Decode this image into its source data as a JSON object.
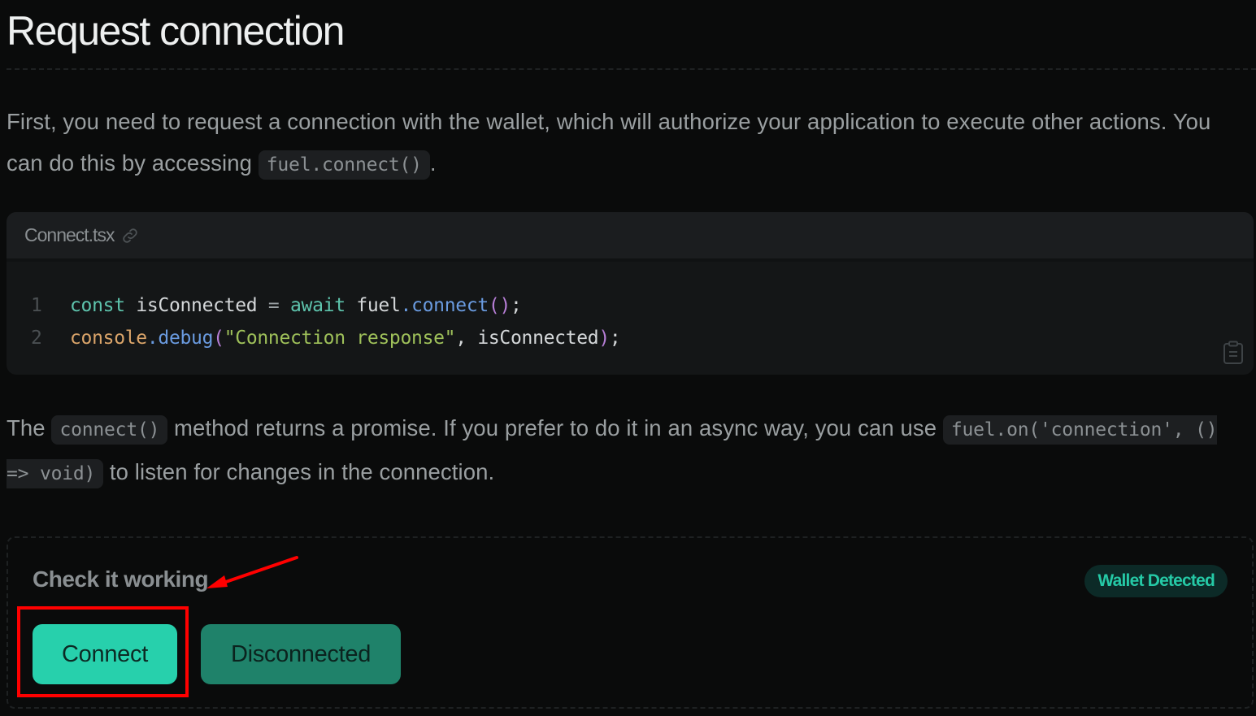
{
  "page": {
    "title": "Request connection"
  },
  "intro": {
    "text_before": "First, you need to request a connection with the wallet, which will authorize your application to execute other actions. You can do this by accessing ",
    "code": "fuel.connect()",
    "text_after": "."
  },
  "code_block": {
    "filename": "Connect.tsx",
    "link_icon": "link-icon",
    "copy_icon": "clipboard-icon",
    "lines": [
      {
        "number": "1",
        "tokens": [
          {
            "t": "const",
            "c": "kw"
          },
          {
            "t": " ",
            "c": "var"
          },
          {
            "t": "isConnected",
            "c": "var"
          },
          {
            "t": " = ",
            "c": "op"
          },
          {
            "t": "await",
            "c": "kw"
          },
          {
            "t": " ",
            "c": "var"
          },
          {
            "t": "fuel",
            "c": "var"
          },
          {
            "t": ".",
            "c": "fn"
          },
          {
            "t": "connect",
            "c": "fn"
          },
          {
            "t": "()",
            "c": "paren"
          },
          {
            "t": ";",
            "c": "punc"
          }
        ]
      },
      {
        "number": "2",
        "tokens": [
          {
            "t": "console",
            "c": "obj"
          },
          {
            "t": ".",
            "c": "fn"
          },
          {
            "t": "debug",
            "c": "fn"
          },
          {
            "t": "(",
            "c": "paren"
          },
          {
            "t": "\"Connection response\"",
            "c": "str"
          },
          {
            "t": ", ",
            "c": "punc"
          },
          {
            "t": "isConnected",
            "c": "var"
          },
          {
            "t": ")",
            "c": "paren"
          },
          {
            "t": ";",
            "c": "punc"
          }
        ]
      }
    ]
  },
  "explanation": {
    "text1": "The ",
    "code1": "connect()",
    "text2": " method returns a promise. If you prefer to do it in an async way, you can use ",
    "code2": "fuel.on('connection', () => void)",
    "text3": " to listen for changes in the connection."
  },
  "demo": {
    "title": "Check it working",
    "badge": "Wallet Detected",
    "connect_label": "Connect",
    "status_label": "Disconnected"
  },
  "colors": {
    "accent": "#27d0ac",
    "accent_dark": "#1f826a",
    "badge_bg": "#0c2a27",
    "annotation": "#ff0000"
  }
}
